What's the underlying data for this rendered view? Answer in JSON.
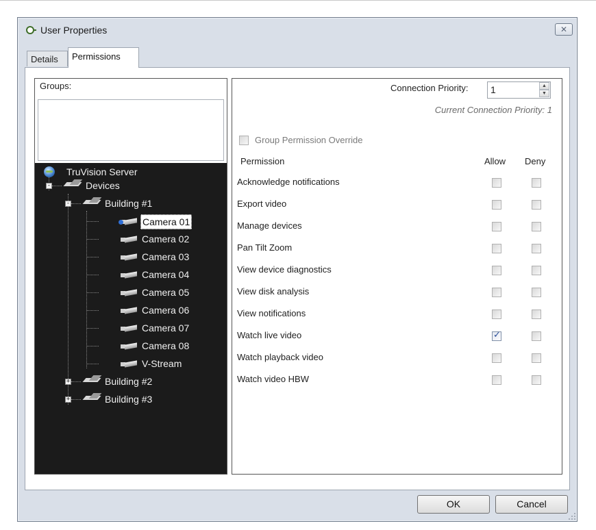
{
  "window": {
    "title": "User Properties",
    "close_symbol": "✕"
  },
  "tabs": [
    {
      "label": "Details",
      "active": false
    },
    {
      "label": "Permissions",
      "active": true
    }
  ],
  "groups": {
    "label": "Groups:"
  },
  "tree": {
    "root": "TruVision Server",
    "devices": "Devices",
    "building1": "Building #1",
    "cameras": [
      "Camera 01",
      "Camera 02",
      "Camera 03",
      "Camera 04",
      "Camera 05",
      "Camera 06",
      "Camera 07",
      "Camera 08",
      "V-Stream"
    ],
    "selected_camera": "Camera 01",
    "building2": "Building #2",
    "building3": "Building #3",
    "expander_minus": "-",
    "expander_plus": "+"
  },
  "connection": {
    "label": "Connection Priority:",
    "value": "1",
    "current": "Current Connection Priority: 1"
  },
  "override": {
    "label": "Group Permission Override",
    "checked": false
  },
  "permissions": {
    "headers": {
      "permission": "Permission",
      "allow": "Allow",
      "deny": "Deny"
    },
    "rows": [
      {
        "name": "Acknowledge notifications",
        "allow": false,
        "deny": false
      },
      {
        "name": "Export video",
        "allow": false,
        "deny": false
      },
      {
        "name": "Manage devices",
        "allow": false,
        "deny": false
      },
      {
        "name": "Pan Tilt Zoom",
        "allow": false,
        "deny": false
      },
      {
        "name": "View device diagnostics",
        "allow": false,
        "deny": false
      },
      {
        "name": "View disk analysis",
        "allow": false,
        "deny": false
      },
      {
        "name": "View notifications",
        "allow": false,
        "deny": false
      },
      {
        "name": "Watch live video",
        "allow": true,
        "deny": false
      },
      {
        "name": "Watch playback video",
        "allow": false,
        "deny": false
      },
      {
        "name": "Watch video HBW",
        "allow": false,
        "deny": false
      }
    ]
  },
  "buttons": {
    "ok": "OK",
    "cancel": "Cancel"
  },
  "colors": {
    "window_bg": "#d9dfe8",
    "tree_bg": "#1b1b1b",
    "selected_dot": "#2f6fd6",
    "check_mark": "#2b4f9a"
  },
  "icons": {
    "title": "status-ring-icon",
    "root": "globe-icon",
    "devices": "device-group-icon",
    "camera": "camera-icon"
  }
}
